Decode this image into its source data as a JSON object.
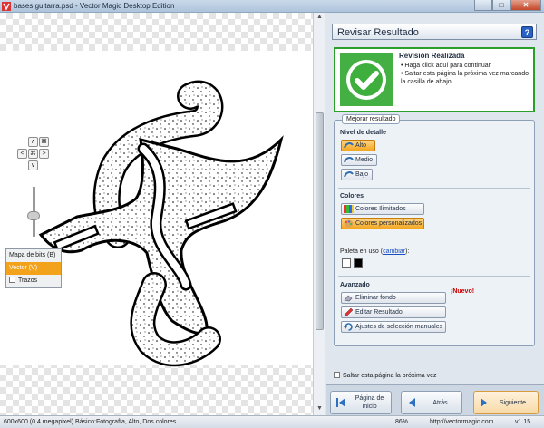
{
  "window": {
    "title": "bases guitarra.psd - Vector Magic Desktop Edition",
    "min_label": "─",
    "max_label": "□",
    "close_label": "✕"
  },
  "canvas": {
    "nav_glyphs": [
      "∧",
      "⌘",
      "<",
      "⌘",
      ">",
      "∨"
    ],
    "view_modes": [
      {
        "label": "Mapa de bits (B)",
        "selected": false
      },
      {
        "label": "Vector (V)",
        "selected": true
      }
    ],
    "strokes_label": "Trazos"
  },
  "status": {
    "info": "600x600 (0.4 megapixel)  Básico:Fotografía, Alto, Dos colores",
    "zoom": "86%",
    "url": "http://vectormagic.com",
    "version": "v1.15"
  },
  "panel": {
    "title": "Revisar Resultado",
    "help": "?",
    "review": {
      "heading": "Revisión Realizada",
      "bullets": [
        "Haga click aquí para continuar.",
        "Saltar esta página la próxima vez marcando la casilla de abajo."
      ]
    },
    "improve_title": "Mejorar resultado",
    "detail": {
      "heading": "Nivel de detalle",
      "options": [
        "Alto",
        "Medio",
        "Bajo"
      ]
    },
    "colors": {
      "heading": "Colores",
      "options": [
        "Colores Ilimitados",
        "Colores personalizados"
      ],
      "palette_prefix": "Paleta en uso (",
      "palette_link": "cambiar",
      "palette_suffix": "):",
      "swatches": [
        "#ffffff",
        "#000000"
      ]
    },
    "advanced": {
      "heading": "Avanzado",
      "options": [
        "Eliminar fondo",
        "Editar Resultado",
        "Ajustes de selección manuales"
      ],
      "new_badge": "¡Nuevo!"
    },
    "skip_label": "Saltar esta página la próxima vez",
    "nav": {
      "home": "Página de Inicio",
      "back": "Atrás",
      "next": "Siguiente"
    }
  }
}
